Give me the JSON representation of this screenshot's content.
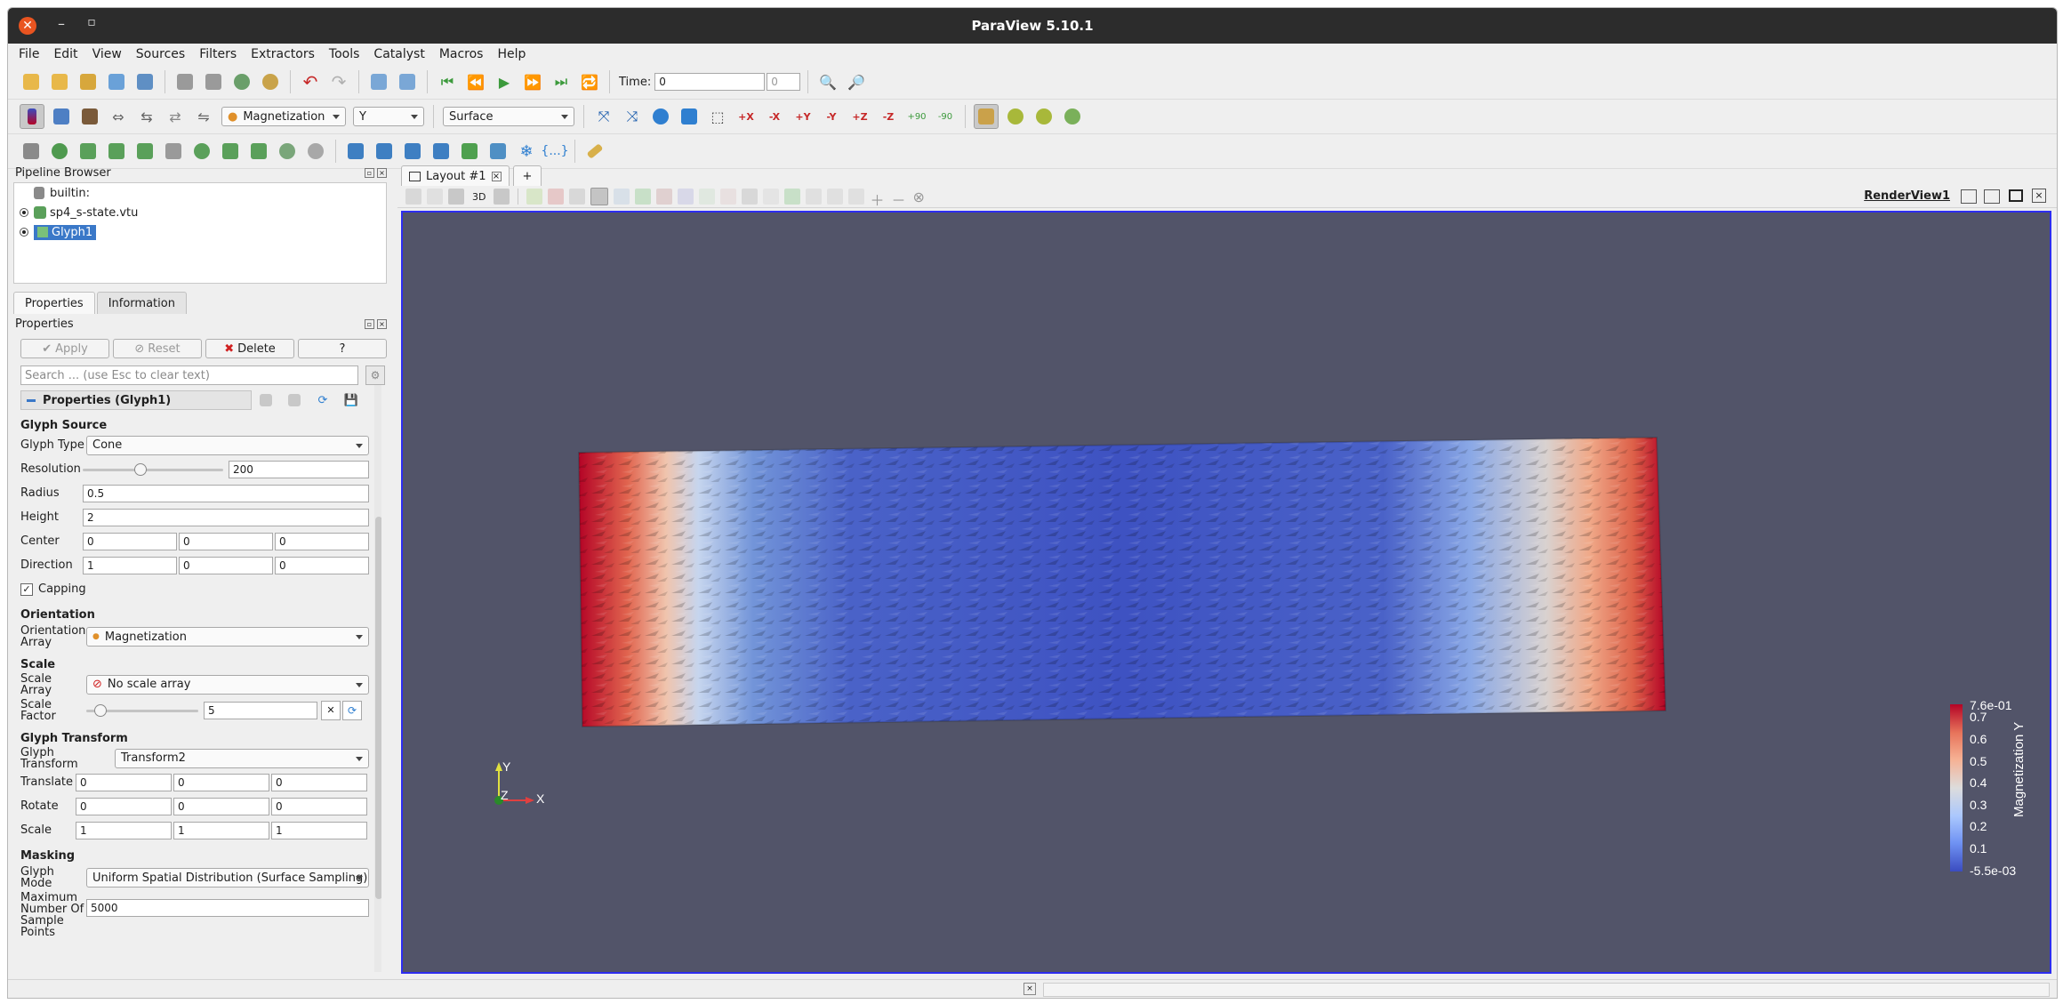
{
  "window": {
    "title": "ParaView 5.10.1"
  },
  "menu": [
    "File",
    "Edit",
    "View",
    "Sources",
    "Filters",
    "Extractors",
    "Tools",
    "Catalyst",
    "Macros",
    "Help"
  ],
  "time": {
    "label": "Time:",
    "value": "0",
    "step": "0"
  },
  "toolbar": {
    "color_array": "Magnetization",
    "component": "Y",
    "representation": "Surface",
    "rot_plus90": "+90",
    "rot_minus90": "-90"
  },
  "pipeline": {
    "title": "Pipeline Browser",
    "items": [
      "builtin:",
      "sp4_s-state.vtu",
      "Glyph1"
    ]
  },
  "tabs": {
    "properties": "Properties",
    "information": "Information"
  },
  "properties": {
    "panel_title": "Properties",
    "apply": "Apply",
    "reset": "Reset",
    "delete": "Delete",
    "help": "?",
    "search_placeholder": "Search ... (use Esc to clear text)",
    "section": "Properties (Glyph1)",
    "glyph_source": "Glyph Source",
    "glyph_type_label": "Glyph Type",
    "glyph_type": "Cone",
    "resolution_label": "Resolution",
    "resolution": "200",
    "resolution_slider": 0.4,
    "radius_label": "Radius",
    "radius": "0.5",
    "height_label": "Height",
    "height": "2",
    "center_label": "Center",
    "center": [
      "0",
      "0",
      "0"
    ],
    "direction_label": "Direction",
    "direction": [
      "1",
      "0",
      "0"
    ],
    "capping_label": "Capping",
    "capping": true,
    "orientation": "Orientation",
    "orientation_array_label": "Orientation Array",
    "orientation_array": "Magnetization",
    "scale": "Scale",
    "scale_array_label": "Scale Array",
    "scale_array": "No scale array",
    "scale_factor_label": "Scale Factor",
    "scale_factor": "5",
    "scale_factor_slider": 0.08,
    "glyph_transform": "Glyph Transform",
    "glyph_transform_label": "Glyph Transform",
    "glyph_transform_value": "Transform2",
    "translate_label": "Translate",
    "translate": [
      "0",
      "0",
      "0"
    ],
    "rotate_label": "Rotate",
    "rotate": [
      "0",
      "0",
      "0"
    ],
    "scale_label": "Scale",
    "scale_xyz": [
      "1",
      "1",
      "1"
    ],
    "masking": "Masking",
    "glyph_mode_label": "Glyph Mode",
    "glyph_mode": "Uniform Spatial Distribution (Surface Sampling)",
    "max_points_label": "Maximum Number Of Sample Points",
    "max_points": "5000"
  },
  "layout": {
    "tab": "Layout #1",
    "add": "+",
    "view_name": "RenderView1",
    "mode3d": "3D"
  },
  "colorbar": {
    "title": "Magnetization Y",
    "max": "7.6e-01",
    "min": "-5.5e-03",
    "ticks": [
      "0.7",
      "0.6",
      "0.5",
      "0.4",
      "0.3",
      "0.2",
      "0.1"
    ],
    "colors": [
      "#3b4cc0",
      "#6f92f3",
      "#aac7fd",
      "#dddcdc",
      "#f6b194",
      "#e7745b",
      "#b40426"
    ]
  },
  "axes": {
    "x": "X",
    "y": "Y",
    "z": "Z"
  }
}
